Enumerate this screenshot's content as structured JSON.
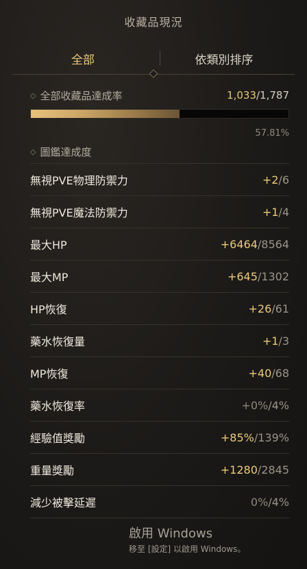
{
  "header": {
    "title": "收藏品現況"
  },
  "tabs": [
    {
      "label": "全部",
      "active": true
    },
    {
      "label": "依類別排序",
      "active": false
    }
  ],
  "summary": {
    "rate_label": "全部收藏品達成率",
    "current": "1,033",
    "total": "/1,787",
    "percent_text": "57.81%",
    "progress_fraction": 0.5781,
    "codex_label": "圖鑑達成度"
  },
  "stats": [
    {
      "name": "無視PVE物理防禦力",
      "current": "+2",
      "sep": "/",
      "total": "6"
    },
    {
      "name": "無視PVE魔法防禦力",
      "current": "+1",
      "sep": "/",
      "total": "4"
    },
    {
      "name": "最大HP",
      "current": "+6464",
      "sep": "/",
      "total": "8564"
    },
    {
      "name": "最大MP",
      "current": "+645",
      "sep": "/",
      "total": "1302"
    },
    {
      "name": "HP恢復",
      "current": "+26",
      "sep": "/",
      "total": "61"
    },
    {
      "name": "藥水恢復量",
      "current": "+1",
      "sep": "/",
      "total": "3"
    },
    {
      "name": "MP恢復",
      "current": "+40",
      "sep": "/",
      "total": "68"
    },
    {
      "name": "藥水恢復率",
      "current": "+0%",
      "sep": "/",
      "total": "4%"
    },
    {
      "name": "經驗值獎勵",
      "current": "+85%",
      "sep": "/",
      "total": "139%"
    },
    {
      "name": "重量獎勵",
      "current": "+1280",
      "sep": "/",
      "total": "2845"
    },
    {
      "name": "減少被擊延遲",
      "current": "0%",
      "sep": "/",
      "total": "4%"
    }
  ],
  "watermark": {
    "title": "啟用 Windows",
    "subtitle": "移至 [設定] 以啟用 Windows。"
  },
  "colors": {
    "accent_gold": "#eccb7c",
    "text": "#eee8dc",
    "muted": "#9b9588"
  }
}
